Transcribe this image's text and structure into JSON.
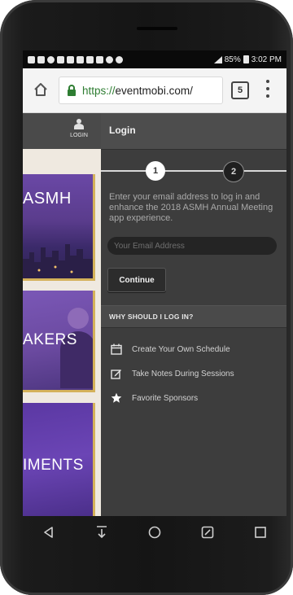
{
  "status_bar": {
    "battery": "85%",
    "time": "3:02 PM"
  },
  "browser": {
    "url_prefix": "https://",
    "url_host": "eventmobi.com/",
    "tab_count": "5"
  },
  "left_panel": {
    "login_label": "LOGIN",
    "tiles": [
      {
        "label": "ASMH"
      },
      {
        "label": "AKERS"
      },
      {
        "label": "IMENTS"
      }
    ]
  },
  "login": {
    "title": "Login",
    "steps": [
      "1",
      "2"
    ],
    "intro": "Enter your email address to log in and enhance the 2018 ASMH Annual Meeting app experience.",
    "email_placeholder": "Your Email Address",
    "continue_label": "Continue"
  },
  "why": {
    "title": "WHY SHOULD I LOG IN?",
    "items": [
      {
        "label": "Create Your Own Schedule",
        "icon": "calendar-icon"
      },
      {
        "label": "Take Notes During Sessions",
        "icon": "edit-note-icon"
      },
      {
        "label": "Favorite Sponsors",
        "icon": "star-icon"
      }
    ]
  },
  "colors": {
    "url_green": "#2e7d32",
    "panel_bg": "#3d3d3d",
    "tile_purple": "#6d46a3",
    "tile_gold": "#d4b15a"
  }
}
